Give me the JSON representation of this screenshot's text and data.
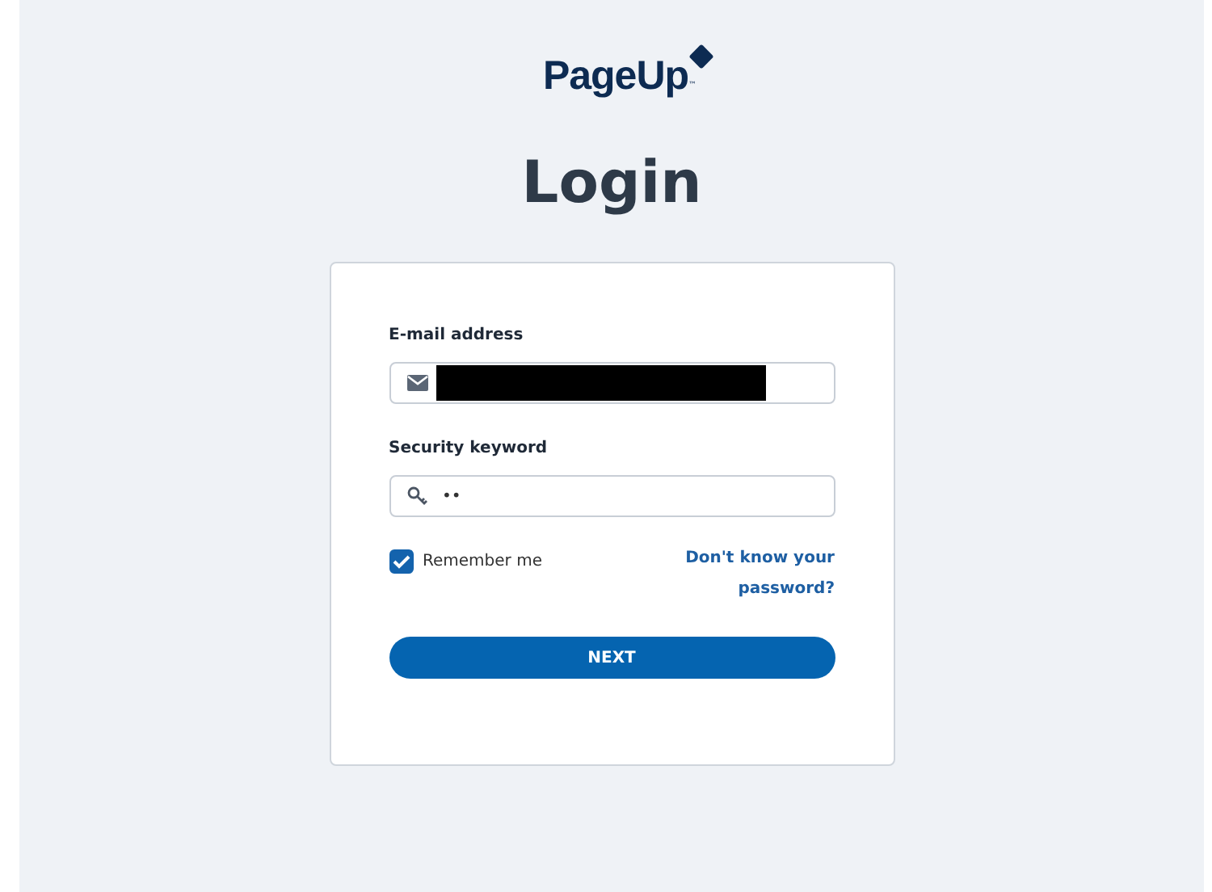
{
  "logo": {
    "text": "PageUp",
    "trademark": "™"
  },
  "heading": "Login",
  "form": {
    "email": {
      "label": "E-mail address",
      "redacted": true
    },
    "password": {
      "label": "Security keyword",
      "value": "••"
    },
    "remember": {
      "label": "Remember me",
      "checked": true
    },
    "forgot_link": "Don't know your password?",
    "submit": "NEXT"
  }
}
